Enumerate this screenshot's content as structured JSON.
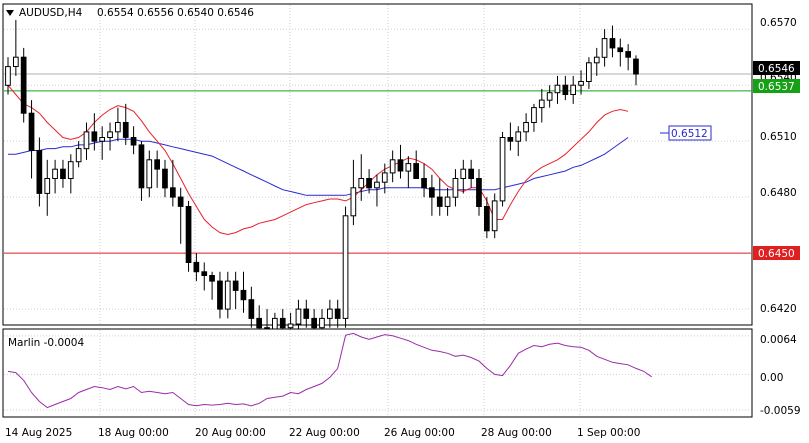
{
  "header": {
    "symbol_tf": "AUDUSD,H4",
    "ohlc": "0.6554 0.6556 0.6540 0.6546"
  },
  "indicator": {
    "label": "Marlin -0.0004"
  },
  "price_axis": {
    "ticks": [
      "0.6570",
      "0.6540",
      "0.6510",
      "0.6480",
      "0.6420"
    ],
    "labels": {
      "current": "0.6546",
      "green_level": "0.6537",
      "blue_ma": "0.6512",
      "red_level": "0.6450"
    }
  },
  "osc_axis": {
    "ticks": [
      "0.0064",
      "0.00",
      "-0.0059"
    ]
  },
  "time_axis": {
    "ticks": [
      "14 Aug 2025",
      "18 Aug 00:00",
      "20 Aug 00:00",
      "22 Aug 00:00",
      "26 Aug 00:00",
      "28 Aug 00:00",
      "1 Sep 00:00"
    ]
  },
  "colors": {
    "bull_candle": "#ffffff",
    "bear_candle": "#000000",
    "red_ma": "#e8202a",
    "blue_ma": "#2a2ad0",
    "green_line": "#16a016",
    "red_line": "#e02020",
    "oscillator": "#9b2ca8",
    "grid": "#cfcfcf"
  },
  "chart_data": {
    "type": "candlestick",
    "price_ylim": [
      0.6412,
      0.6583
    ],
    "osc_ylim": [
      -0.0069,
      0.0072
    ],
    "levels": [
      0.6537,
      0.645
    ],
    "candles": [
      [
        0.654,
        0.6555,
        0.6535,
        0.655
      ],
      [
        0.655,
        0.6575,
        0.6545,
        0.6555
      ],
      [
        0.6555,
        0.656,
        0.652,
        0.6525
      ],
      [
        0.6525,
        0.6532,
        0.649,
        0.6505
      ],
      [
        0.6505,
        0.6512,
        0.6475,
        0.6482
      ],
      [
        0.6482,
        0.65,
        0.647,
        0.649
      ],
      [
        0.649,
        0.65,
        0.6482,
        0.6495
      ],
      [
        0.6495,
        0.65,
        0.6485,
        0.649
      ],
      [
        0.649,
        0.6503,
        0.6482,
        0.6499
      ],
      [
        0.6499,
        0.651,
        0.6496,
        0.6506
      ],
      [
        0.6506,
        0.652,
        0.65,
        0.6515
      ],
      [
        0.6515,
        0.6525,
        0.6505,
        0.651
      ],
      [
        0.651,
        0.6518,
        0.65,
        0.6512
      ],
      [
        0.6512,
        0.652,
        0.6505,
        0.6515
      ],
      [
        0.6515,
        0.6528,
        0.651,
        0.652
      ],
      [
        0.652,
        0.653,
        0.6508,
        0.6512
      ],
      [
        0.6512,
        0.6518,
        0.6503,
        0.6508
      ],
      [
        0.6508,
        0.651,
        0.6478,
        0.6485
      ],
      [
        0.6485,
        0.6505,
        0.648,
        0.65
      ],
      [
        0.65,
        0.6505,
        0.6485,
        0.6495
      ],
      [
        0.6495,
        0.65,
        0.648,
        0.6485
      ],
      [
        0.6485,
        0.65,
        0.6475,
        0.648
      ],
      [
        0.648,
        0.6485,
        0.6455,
        0.6475
      ],
      [
        0.6475,
        0.6478,
        0.644,
        0.6445
      ],
      [
        0.6445,
        0.645,
        0.6435,
        0.644
      ],
      [
        0.644,
        0.6445,
        0.643,
        0.6438
      ],
      [
        0.6438,
        0.644,
        0.6425,
        0.6435
      ],
      [
        0.6435,
        0.644,
        0.6415,
        0.642
      ],
      [
        0.642,
        0.644,
        0.6415,
        0.6435
      ],
      [
        0.6435,
        0.644,
        0.642,
        0.643
      ],
      [
        0.643,
        0.644,
        0.6418,
        0.6425
      ],
      [
        0.6425,
        0.6432,
        0.641,
        0.6415
      ],
      [
        0.6415,
        0.6422,
        0.6405,
        0.641
      ],
      [
        0.641,
        0.642,
        0.6402,
        0.6408
      ],
      [
        0.6408,
        0.6418,
        0.6403,
        0.6415
      ],
      [
        0.6415,
        0.642,
        0.6405,
        0.641
      ],
      [
        0.641,
        0.6418,
        0.6403,
        0.6412
      ],
      [
        0.6412,
        0.6425,
        0.6408,
        0.642
      ],
      [
        0.642,
        0.6425,
        0.641,
        0.6415
      ],
      [
        0.6415,
        0.642,
        0.6405,
        0.641
      ],
      [
        0.641,
        0.642,
        0.64,
        0.6415
      ],
      [
        0.6415,
        0.6425,
        0.641,
        0.642
      ],
      [
        0.642,
        0.6425,
        0.641,
        0.6415
      ],
      [
        0.6415,
        0.6475,
        0.641,
        0.647
      ],
      [
        0.647,
        0.65,
        0.6465,
        0.6485
      ],
      [
        0.6485,
        0.6503,
        0.6478,
        0.649
      ],
      [
        0.649,
        0.6495,
        0.6482,
        0.6485
      ],
      [
        0.6485,
        0.6492,
        0.6475,
        0.6488
      ],
      [
        0.6488,
        0.6498,
        0.6482,
        0.6493
      ],
      [
        0.6493,
        0.6505,
        0.6488,
        0.65
      ],
      [
        0.65,
        0.6508,
        0.649,
        0.6494
      ],
      [
        0.6494,
        0.6502,
        0.6485,
        0.6498
      ],
      [
        0.6498,
        0.6505,
        0.649,
        0.649
      ],
      [
        0.649,
        0.6498,
        0.648,
        0.6485
      ],
      [
        0.6485,
        0.6492,
        0.647,
        0.648
      ],
      [
        0.648,
        0.649,
        0.647,
        0.6475
      ],
      [
        0.6475,
        0.6485,
        0.647,
        0.648
      ],
      [
        0.648,
        0.6495,
        0.6475,
        0.649
      ],
      [
        0.649,
        0.65,
        0.6482,
        0.6495
      ],
      [
        0.6495,
        0.65,
        0.6485,
        0.649
      ],
      [
        0.649,
        0.6495,
        0.647,
        0.6475
      ],
      [
        0.6475,
        0.648,
        0.6458,
        0.6462
      ],
      [
        0.6462,
        0.6482,
        0.6458,
        0.6478
      ],
      [
        0.6478,
        0.6515,
        0.6475,
        0.6512
      ],
      [
        0.6512,
        0.652,
        0.6505,
        0.651
      ],
      [
        0.651,
        0.6518,
        0.6502,
        0.6515
      ],
      [
        0.6515,
        0.6525,
        0.651,
        0.652
      ],
      [
        0.652,
        0.653,
        0.6515,
        0.6528
      ],
      [
        0.6528,
        0.6538,
        0.652,
        0.6532
      ],
      [
        0.6532,
        0.654,
        0.6528,
        0.6536
      ],
      [
        0.6536,
        0.6545,
        0.653,
        0.654
      ],
      [
        0.654,
        0.6545,
        0.6532,
        0.6535
      ],
      [
        0.6535,
        0.6545,
        0.653,
        0.654
      ],
      [
        0.654,
        0.6548,
        0.6535,
        0.6542
      ],
      [
        0.6542,
        0.6555,
        0.6538,
        0.6552
      ],
      [
        0.6552,
        0.656,
        0.6545,
        0.6555
      ],
      [
        0.6555,
        0.657,
        0.655,
        0.6565
      ],
      [
        0.6565,
        0.6572,
        0.6555,
        0.656
      ],
      [
        0.656,
        0.6565,
        0.655,
        0.6558
      ],
      [
        0.6558,
        0.6562,
        0.6548,
        0.6555
      ],
      [
        0.6554,
        0.6556,
        0.654,
        0.6546
      ]
    ],
    "red_ma": [
      0.654,
      0.6535,
      0.653,
      0.6528,
      0.6525,
      0.652,
      0.6516,
      0.6512,
      0.6511,
      0.6512,
      0.6515,
      0.652,
      0.6524,
      0.6527,
      0.6529,
      0.6528,
      0.6526,
      0.6521,
      0.6515,
      0.651,
      0.6505,
      0.6498,
      0.649,
      0.6482,
      0.6475,
      0.6468,
      0.6464,
      0.6461,
      0.646,
      0.6461,
      0.6463,
      0.6464,
      0.6466,
      0.6467,
      0.6468,
      0.647,
      0.6472,
      0.6474,
      0.6476,
      0.6477,
      0.6478,
      0.6479,
      0.6479,
      0.6478,
      0.648,
      0.6484,
      0.6488,
      0.6492,
      0.6495,
      0.6497,
      0.6499,
      0.6501,
      0.65,
      0.6498,
      0.6495,
      0.649,
      0.6486,
      0.6484,
      0.6483,
      0.6485,
      0.6485,
      0.6478,
      0.6468,
      0.6468,
      0.6476,
      0.6483,
      0.6489,
      0.6493,
      0.6496,
      0.6498,
      0.65,
      0.6503,
      0.6507,
      0.6511,
      0.6515,
      0.652,
      0.6524,
      0.6526,
      0.6527,
      0.6526
    ],
    "blue_ma": [
      0.6503,
      0.6503,
      0.6504,
      0.6505,
      0.6505,
      0.6506,
      0.6506,
      0.6507,
      0.6507,
      0.6508,
      0.6508,
      0.6509,
      0.651,
      0.651,
      0.6511,
      0.6511,
      0.6511,
      0.651,
      0.651,
      0.6509,
      0.6508,
      0.6507,
      0.6506,
      0.6505,
      0.6504,
      0.6503,
      0.6502,
      0.65,
      0.6498,
      0.6496,
      0.6494,
      0.6492,
      0.649,
      0.6488,
      0.6486,
      0.6484,
      0.6483,
      0.6482,
      0.6481,
      0.6481,
      0.6481,
      0.6481,
      0.6481,
      0.6481,
      0.6482,
      0.6483,
      0.6484,
      0.6484,
      0.6485,
      0.6485,
      0.6485,
      0.6485,
      0.6485,
      0.6485,
      0.6484,
      0.6484,
      0.6484,
      0.6484,
      0.6484,
      0.6484,
      0.6484,
      0.6484,
      0.6484,
      0.6485,
      0.6486,
      0.6487,
      0.6488,
      0.649,
      0.6491,
      0.6492,
      0.6493,
      0.6494,
      0.6496,
      0.6497,
      0.6499,
      0.6501,
      0.6503,
      0.6506,
      0.6509,
      0.6512
    ],
    "osc": [
      0.0005,
      0.0003,
      -0.001,
      -0.003,
      -0.0045,
      -0.0055,
      -0.005,
      -0.0045,
      -0.004,
      -0.003,
      -0.0025,
      -0.002,
      -0.0022,
      -0.0025,
      -0.002,
      -0.0024,
      -0.002,
      -0.003,
      -0.0028,
      -0.003,
      -0.0032,
      -0.003,
      -0.004,
      -0.005,
      -0.0052,
      -0.005,
      -0.0051,
      -0.005,
      -0.0048,
      -0.005,
      -0.0049,
      -0.0052,
      -0.0048,
      -0.004,
      -0.0038,
      -0.0036,
      -0.003,
      -0.0032,
      -0.0025,
      -0.002,
      -0.0015,
      -0.0005,
      0.001,
      0.0065,
      0.0068,
      0.0062,
      0.0058,
      0.0062,
      0.0066,
      0.0064,
      0.006,
      0.0056,
      0.005,
      0.0045,
      0.004,
      0.0038,
      0.0035,
      0.003,
      0.0032,
      0.0028,
      0.0022,
      0.001,
      0.0,
      -0.0002,
      0.0015,
      0.0035,
      0.0042,
      0.0048,
      0.0046,
      0.005,
      0.0052,
      0.0048,
      0.0046,
      0.0045,
      0.004,
      0.003,
      0.0025,
      0.002,
      0.0018,
      0.0016,
      0.001,
      0.0005,
      -0.0004
    ]
  }
}
